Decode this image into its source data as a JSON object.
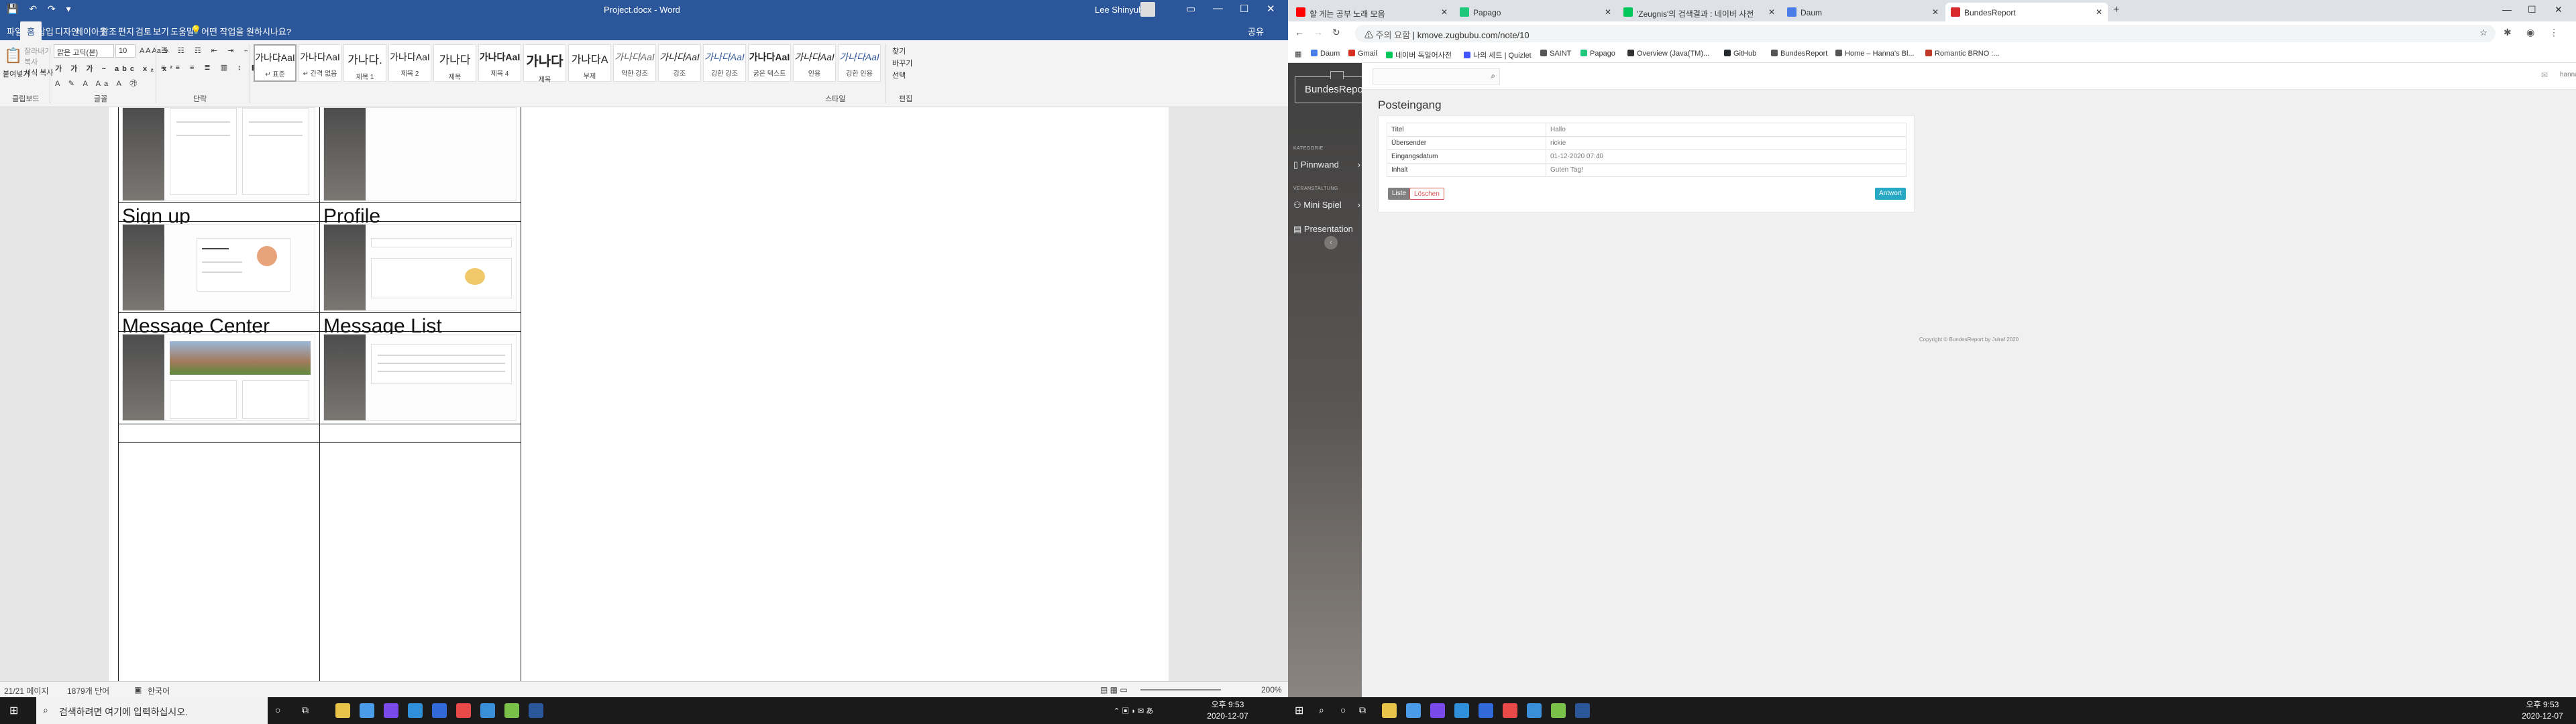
{
  "word": {
    "qat": "💾 ↶ ↷ ▾",
    "doc_title": "Project.docx - Word",
    "user": "Lee Shinyub",
    "window_controls": [
      "▭",
      "—",
      "☐",
      "✕"
    ],
    "tabs": [
      "파일",
      "홈",
      "삽입",
      "디자인",
      "레이아웃",
      "참조",
      "편지",
      "검토",
      "보기",
      "도움말"
    ],
    "tell_me": "어떤 작업을 원하시나요?",
    "share": "공유",
    "font_name": "맑은 고딕(본)",
    "font_size": "10",
    "clipboard": {
      "paste": "붙여넣기",
      "cut": "잘라내기",
      "copy": "복사",
      "format_painter": "서식 복사"
    },
    "groups": {
      "clipboard": "클립보드",
      "font": "글꼴",
      "paragraph": "단락",
      "styles": "스타일",
      "editing": "편집"
    },
    "styles": [
      {
        "sample": "가나다AaI",
        "name": "↵ 표준"
      },
      {
        "sample": "가나다AaI",
        "name": "↵ 간격 없음"
      },
      {
        "sample": "가나다.",
        "name": "제목 1"
      },
      {
        "sample": "가나다AaI",
        "name": "제목 2"
      },
      {
        "sample": "가나다",
        "name": "제목"
      },
      {
        "sample": "가나다AaI",
        "name": "제목 4"
      },
      {
        "sample": "가나다",
        "name": "제목"
      },
      {
        "sample": "가나다A",
        "name": "부제"
      },
      {
        "sample": "가나다AaI",
        "name": "약한 강조"
      },
      {
        "sample": "가나다AaI",
        "name": "강조"
      },
      {
        "sample": "가나다AaI",
        "name": "강한 강조"
      },
      {
        "sample": "가나다AaI",
        "name": "굵은 텍스트"
      },
      {
        "sample": "가나다AaI",
        "name": "인용"
      },
      {
        "sample": "가나다AaI",
        "name": "강한 인용"
      }
    ],
    "editing": {
      "find": "찾기",
      "replace": "바꾸기",
      "select": "선택"
    },
    "doc_headings": [
      "Sign up",
      "Profile",
      "Message Center",
      "Message List"
    ],
    "status": {
      "page": "21/21 페이지",
      "words": "1879개 단어",
      "lang": "한국어",
      "zoom": "200%"
    }
  },
  "taskbar_left": {
    "search_placeholder": "검색하려면 여기에 입력하십시오.",
    "time": "오후 9:53",
    "date": "2020-12-07",
    "app_colors": [
      "#e8c34a",
      "#4a9be8",
      "#7a4ae8",
      "#2f8fd8",
      "#2f6ad8",
      "#e84a4a",
      "#3a8fd8",
      "#7ac14a",
      "#2b579a"
    ]
  },
  "browser": {
    "tabs": [
      {
        "title": "할 게는 공부 노래 모음",
        "color": "#ff0000"
      },
      {
        "title": "Papago",
        "color": "#1fc77b"
      },
      {
        "title": "'Zeugnis'의 검색결과 : 네이버 사전",
        "color": "#03c75a"
      },
      {
        "title": "Daum",
        "color": "#4a7de8"
      },
      {
        "title": "BundesReport",
        "color": "#d92b2b"
      }
    ],
    "active_tab": "BundesReport",
    "url_prefix": "주의 요함",
    "url": "kmove.zugbubu.com/note/10",
    "bookmarks": [
      {
        "label": "Daum",
        "color": "#4a7de8"
      },
      {
        "label": "Gmail",
        "color": "#d93025"
      },
      {
        "label": "네이버 독일어사전",
        "color": "#03c75a"
      },
      {
        "label": "나의 세트 | Quizlet",
        "color": "#4255ff"
      },
      {
        "label": "SAINT",
        "color": "#555555"
      },
      {
        "label": "Papago",
        "color": "#1fc77b"
      },
      {
        "label": "Overview (Java(TM)...",
        "color": "#333333"
      },
      {
        "label": "GitHub",
        "color": "#24292e"
      },
      {
        "label": "BundesReport",
        "color": "#555555"
      },
      {
        "label": "Home – Hanna's Bl...",
        "color": "#555555"
      },
      {
        "label": "Romantic BRNO :...",
        "color": "#c0392b"
      }
    ]
  },
  "app": {
    "brand": "BundesReport",
    "user": "hanna",
    "categories": [
      {
        "label": "KATEGORIE",
        "items": [
          {
            "label": "Pinnwand",
            "icon": "▯"
          }
        ]
      },
      {
        "label": "VERANSTALTUNG",
        "items": [
          {
            "label": "Mini Spiel",
            "icon": "⚇"
          }
        ]
      }
    ],
    "extra_item": {
      "label": "Presentation",
      "icon": "▤"
    },
    "page_title": "Posteingang",
    "message": [
      {
        "label": "Titel",
        "value": "Hallo"
      },
      {
        "label": "Übersender",
        "value": "rickie"
      },
      {
        "label": "Eingangsdatum",
        "value": "01-12-2020 07:40"
      },
      {
        "label": "Inhalt",
        "value": "Guten Tag!"
      }
    ],
    "buttons": {
      "list": "Liste",
      "delete": "Löschen",
      "reply": "Antwort"
    },
    "footer": "Copyright © BundesReport by Julraf 2020"
  },
  "taskbar_right": {
    "time": "오후 9:53",
    "date": "2020-12-07"
  }
}
